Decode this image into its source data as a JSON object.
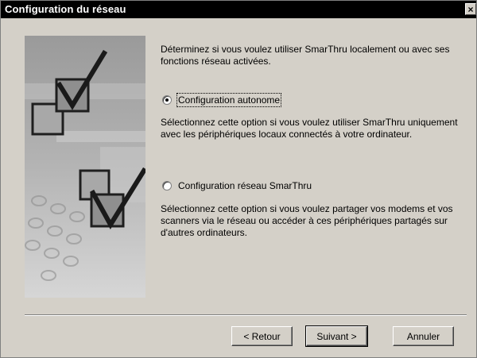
{
  "window": {
    "title": "Configuration du réseau",
    "close_label": "×"
  },
  "intro_text": "Déterminez si vous voulez utiliser SmarThru localement ou avec ses fonctions réseau activées.",
  "options": [
    {
      "label": "Configuration autonome",
      "checked": true,
      "description": "Sélectionnez cette option si vous voulez utiliser SmarThru uniquement avec les périphériques locaux connectés à votre ordinateur."
    },
    {
      "label": "Configuration réseau SmarThru",
      "checked": false,
      "description": "Sélectionnez cette option si vous voulez partager vos modems et vos scanners via le réseau ou accéder à ces périphériques partagés sur d'autres ordinateurs."
    }
  ],
  "buttons": {
    "back": "< Retour",
    "next": "Suivant >",
    "cancel": "Annuler"
  },
  "colors": {
    "title_bar": "#000000",
    "dialog_face": "#d4d0c8"
  }
}
